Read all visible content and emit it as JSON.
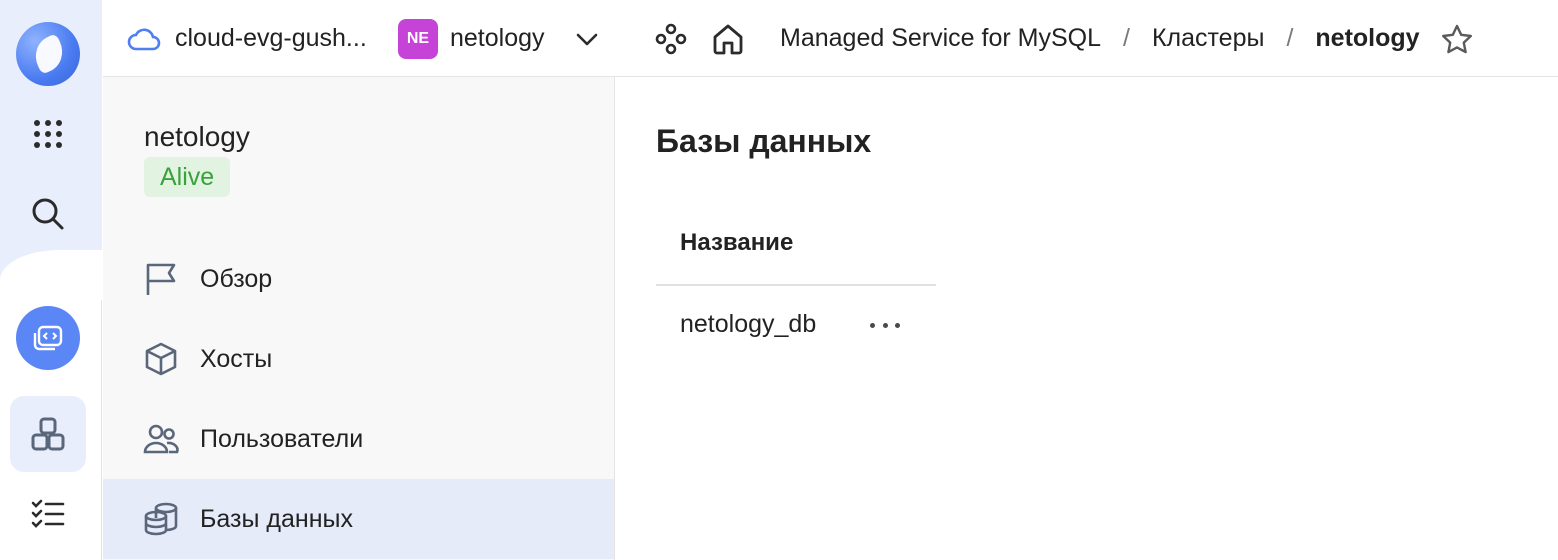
{
  "header": {
    "cloud_name": "cloud-evg-gush...",
    "org_badge": "NE",
    "folder_name": "netology",
    "breadcrumb": {
      "service": "Managed Service for MySQL",
      "separator": "/",
      "clusters": "Кластеры",
      "current": "netology"
    }
  },
  "sidebar": {
    "cluster_name": "netology",
    "status": "Alive",
    "items": [
      {
        "label": "Обзор",
        "icon": "flag-icon"
      },
      {
        "label": "Хосты",
        "icon": "cube-icon"
      },
      {
        "label": "Пользователи",
        "icon": "users-icon"
      },
      {
        "label": "Базы данных",
        "icon": "database-icon",
        "active": true
      }
    ]
  },
  "main": {
    "title": "Базы данных",
    "table": {
      "columns": [
        "Название"
      ],
      "rows": [
        {
          "name": "netology_db"
        }
      ]
    }
  },
  "colors": {
    "accent": "#5b86f5",
    "status_bg": "#e2f3e2",
    "status_text": "#3aa23a",
    "active_nav": "#e5ebf9",
    "org_badge": "#c543d6"
  }
}
